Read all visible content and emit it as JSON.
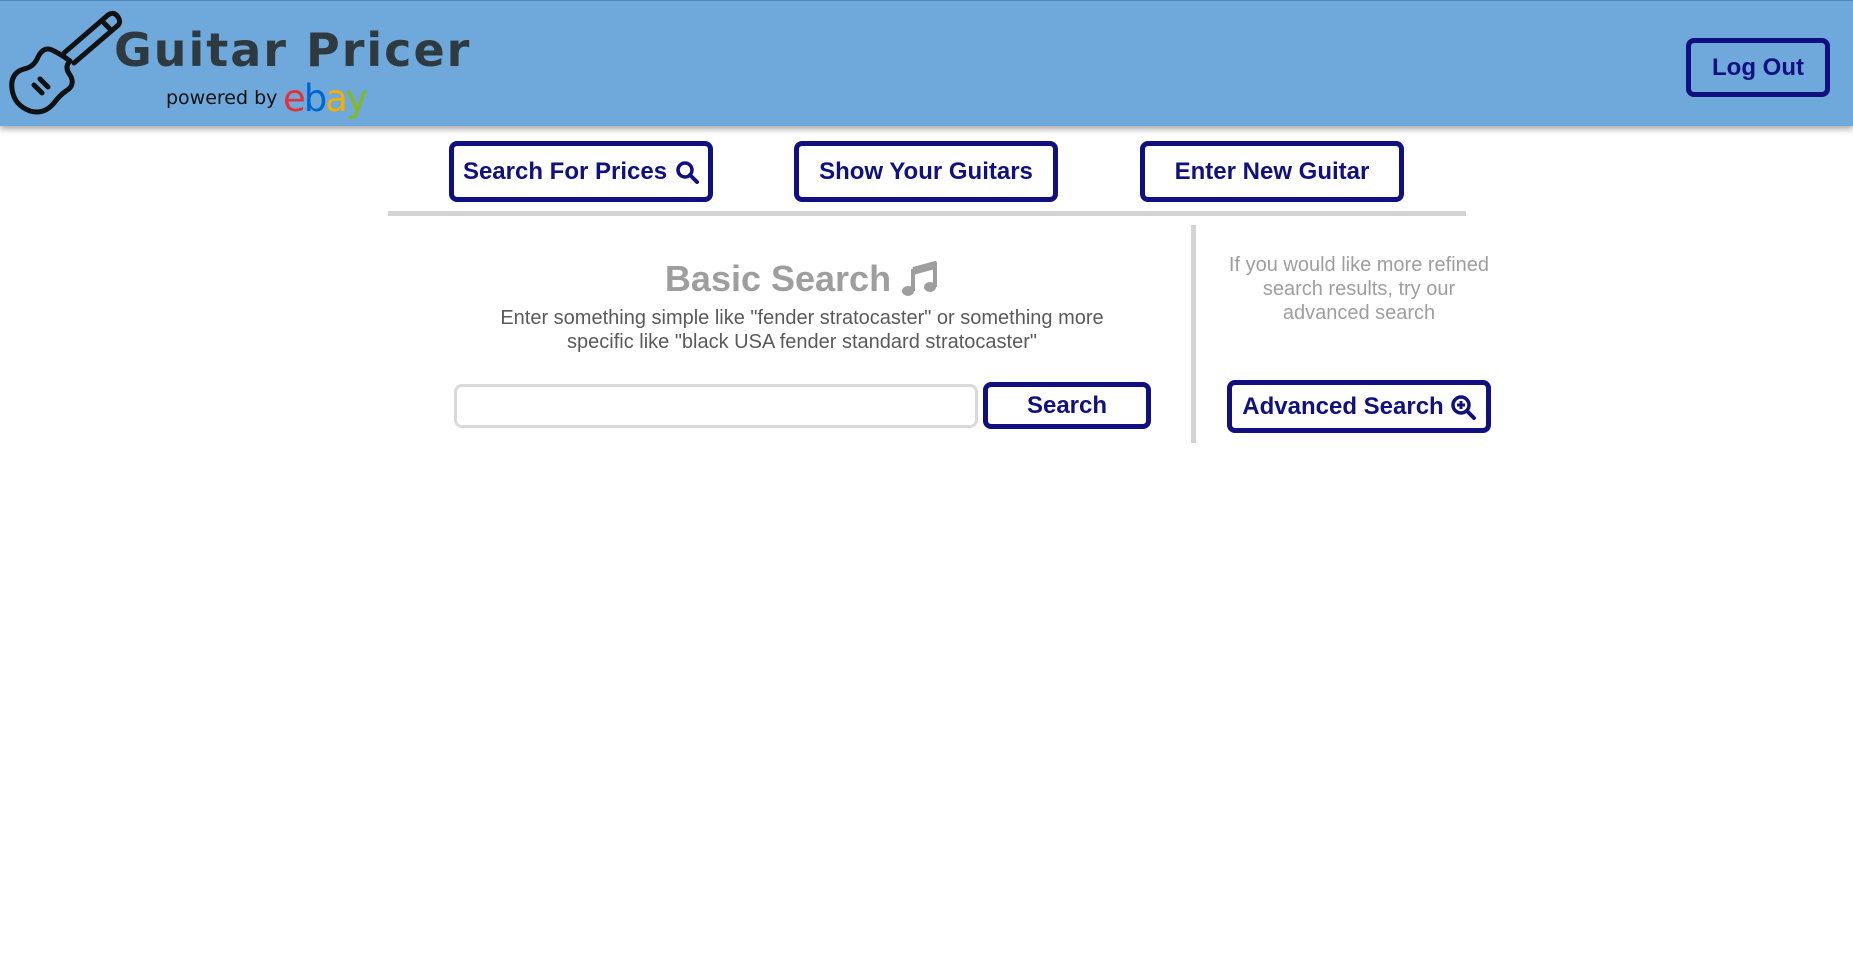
{
  "header": {
    "title": "Guitar Pricer",
    "powered_by": "powered by",
    "ebay_letters": [
      {
        "char": "e",
        "color": "#e53238"
      },
      {
        "char": "b",
        "color": "#0064d2"
      },
      {
        "char": "a",
        "color": "#f5af02"
      },
      {
        "char": "y",
        "color": "#86b817"
      }
    ],
    "logout_label": "Log Out",
    "logo_icon": "guitar-icon"
  },
  "nav": {
    "search_prices_label": "Search For Prices",
    "search_prices_icon": "search-icon",
    "show_guitars_label": "Show Your Guitars",
    "enter_guitar_label": "Enter New Guitar"
  },
  "basic_search": {
    "title": "Basic Search",
    "title_icon": "music-note-icon",
    "description": "Enter something simple like \"fender stratocaster\" or something more specific like \"black USA fender standard stratocaster\"",
    "input_value": "",
    "input_placeholder": "",
    "button_label": "Search"
  },
  "advanced": {
    "text": "If you would like more refined search results, try our advanced search",
    "button_label": "Advanced Search",
    "button_icon": "zoom-in-icon"
  },
  "colors": {
    "header_bg": "#6fa8da",
    "accent": "#101080",
    "muted_text": "#9e9e9e",
    "divider": "#d4d4d4"
  }
}
